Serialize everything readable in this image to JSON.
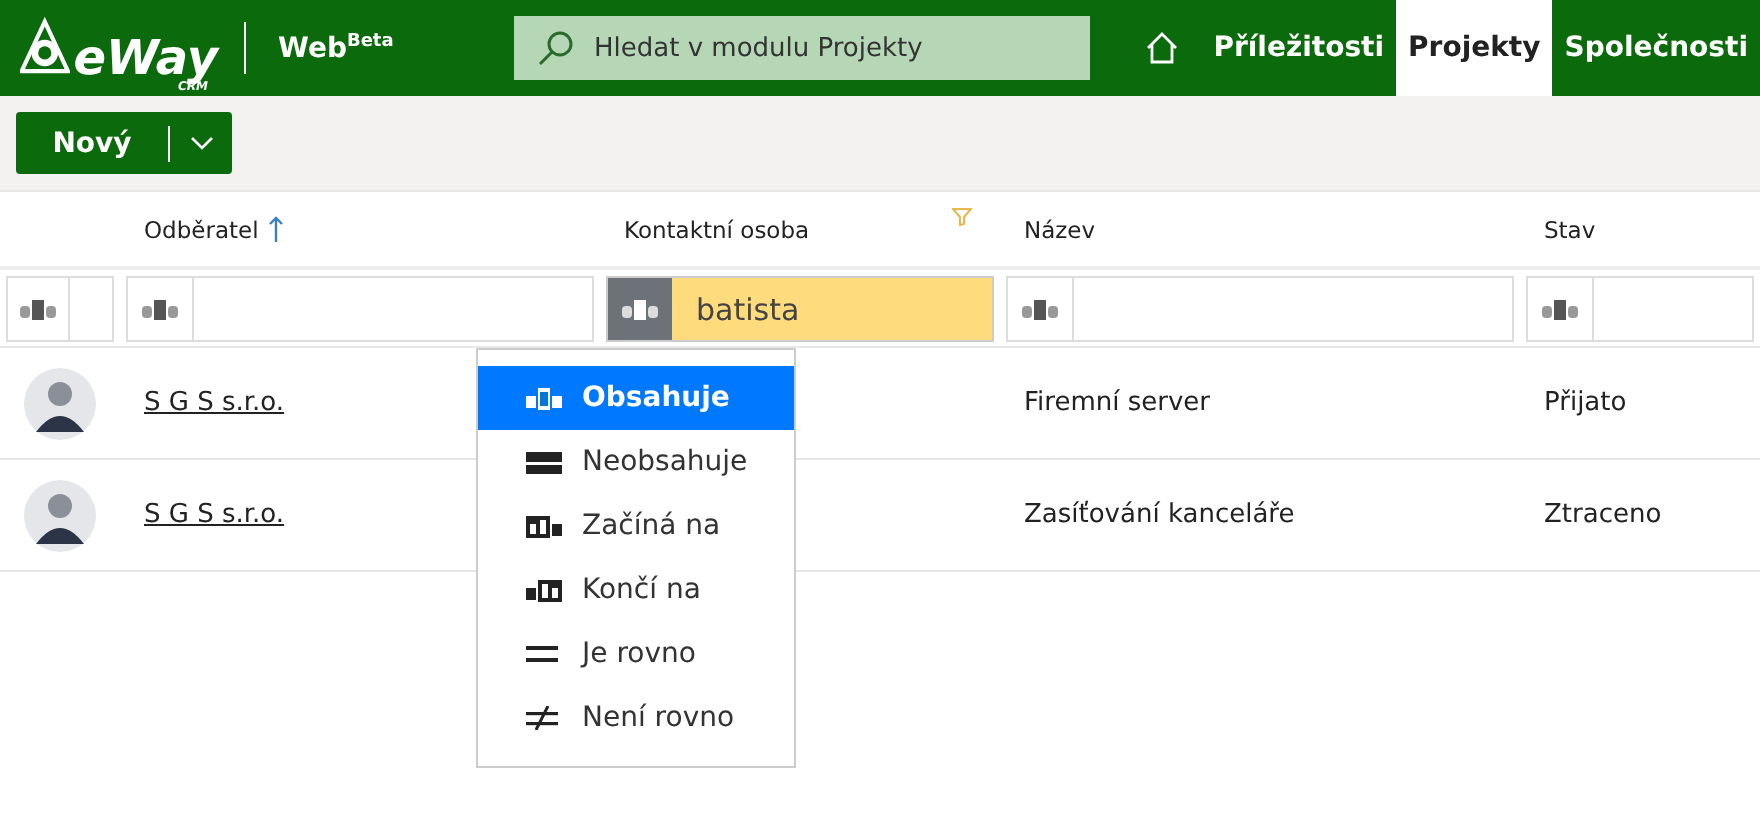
{
  "header": {
    "logo": "eWay",
    "logo_sub": "CRM",
    "app": "Web$^{Beta}$",
    "search": {
      "placeholder": "Hledat v modulu Projekty"
    },
    "nav": [
      {
        "label": "Příležitosti",
        "selected": false
      },
      {
        "label": "Projekty",
        "selected": true
      },
      {
        "label": "Společnosti",
        "selected": false
      }
    ]
  },
  "toolbar": {
    "new_button": "Nový"
  },
  "table": {
    "columns": [
      {
        "label": "Odběratel",
        "sorted": true,
        "filtered": false
      },
      {
        "label": "Kontaktní osoba",
        "sorted": false,
        "filtered": true
      },
      {
        "label": "Název",
        "sorted": false,
        "filtered": false
      },
      {
        "label": "Stav",
        "sorted": false,
        "filtered": false
      }
    ],
    "filters": [
      {
        "active": false
      },
      {
        "value": "batista",
        "active": true
      },
      {
        "active": false
      },
      {
        "active": false
      }
    ],
    "rows": [
      {
        "customer": "S G S s.r.o.",
        "name": "Firemní server",
        "status": "Přijato"
      },
      {
        "customer": "S G S s.r.o.",
        "name": "Zasíťování kanceláře",
        "status": "Ztraceno"
      }
    ]
  },
  "filter_menu": [
    {
      "kind": "contains",
      "label": "Obsahuje",
      "selected": true
    },
    {
      "kind": "not_contains",
      "label": "Neobsahuje",
      "selected": false
    },
    {
      "kind": "starts",
      "label": "Začíná na",
      "selected": false
    },
    {
      "kind": "ends",
      "label": "Končí na",
      "selected": false
    },
    {
      "kind": "equals",
      "label": "Je rovno",
      "selected": false
    },
    {
      "kind": "not_equals",
      "label": "Není rovno",
      "selected": false
    }
  ]
}
